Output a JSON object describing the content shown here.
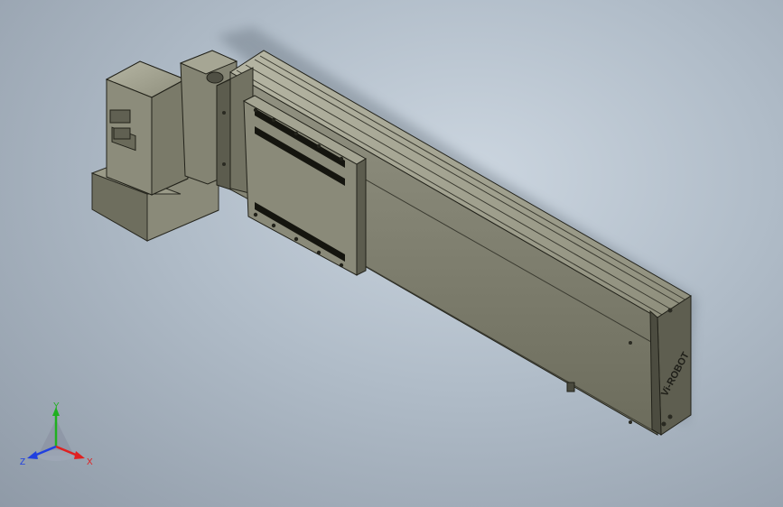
{
  "viewport": {
    "background_top": "#ccd6e0",
    "background_bottom": "#8f9aa7",
    "part_color": "#808070"
  },
  "model": {
    "brand_text": "Vi-ROBOT",
    "icons": [
      "motor-housing",
      "linear-actuator-body",
      "carriage-plate"
    ]
  },
  "triad": {
    "x_label": "X",
    "y_label": "Y",
    "z_label": "Z",
    "x_color": "#e02020",
    "y_color": "#20b020",
    "z_color": "#2040e0"
  }
}
